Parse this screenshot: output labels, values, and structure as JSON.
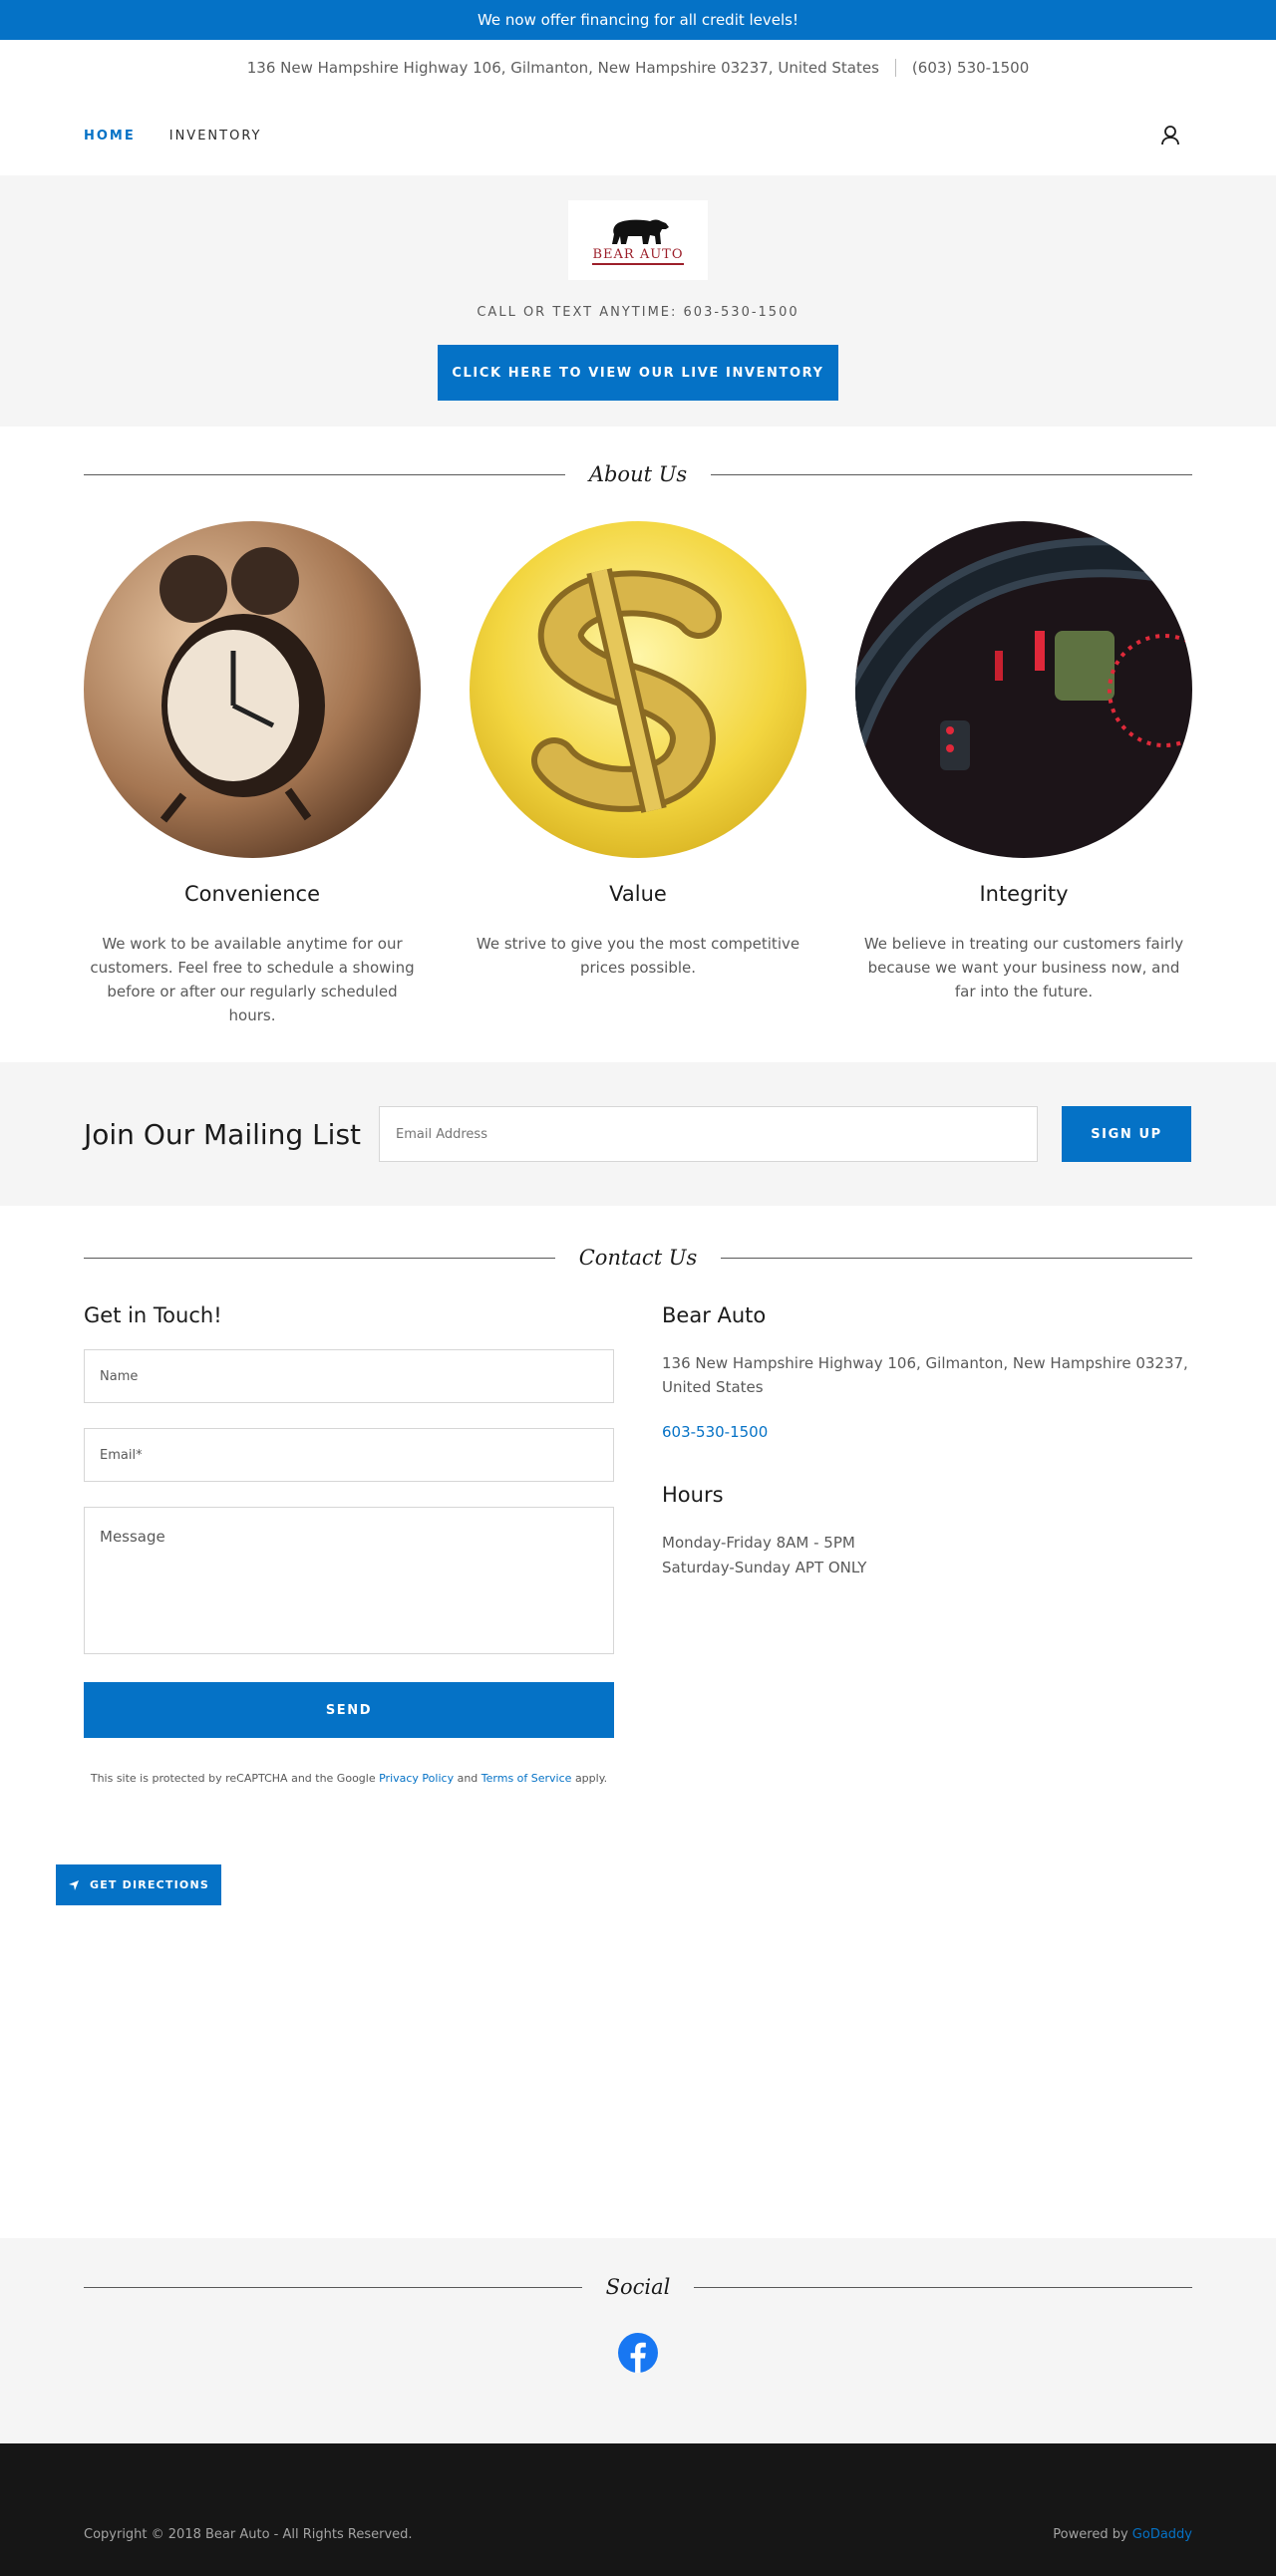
{
  "announcement": "We now offer financing for all credit levels!",
  "contact_bar": {
    "address": "136 New Hampshire Highway 106, Gilmanton, New Hampshire 03237, United States",
    "phone": "(603) 530-1500"
  },
  "nav": {
    "items": [
      {
        "label": "Home",
        "active": true
      },
      {
        "label": "Inventory",
        "active": false
      }
    ],
    "account_icon": "user-icon"
  },
  "hero": {
    "logo_text": "BEAR AUTO",
    "tagline": "CALL OR TEXT ANYTIME: 603-530-1500",
    "cta_label": "CLICK HERE TO VIEW OUR LIVE INVENTORY"
  },
  "about": {
    "heading": "About Us",
    "features": [
      {
        "title": "Convenience",
        "text": "We work to be available anytime for our customers.  Feel free to schedule a showing before or after our regularly scheduled hours.",
        "image": "alarm-clock"
      },
      {
        "title": "Value",
        "text": "We strive to give you the most competitive prices possible.",
        "image": "gold-dollar-sign"
      },
      {
        "title": "Integrity",
        "text": "We believe in treating our customers fairly because we want your business now, and far into the future.",
        "image": "car-dashboard"
      }
    ]
  },
  "mailing": {
    "heading": "Join Our Mailing List",
    "email_placeholder": "Email Address",
    "signup_label": "SIGN UP"
  },
  "contact": {
    "heading": "Contact Us",
    "form_title": "Get in Touch!",
    "name_placeholder": "Name",
    "email_placeholder": "Email*",
    "message_placeholder": "Message",
    "send_label": "SEND",
    "recaptcha_prefix": "This site is protected by reCAPTCHA and the Google",
    "privacy_link": "Privacy Policy",
    "recaptcha_and": "and",
    "terms_link": "Terms of Service",
    "recaptcha_suffix": "apply.",
    "business_name": "Bear Auto",
    "address": "136 New Hampshire Highway 106, Gilmanton, New Hampshire 03237, United States",
    "phone": "603-530-1500",
    "hours_title": "Hours",
    "hours_weekday": "Monday-Friday 8AM - 5PM",
    "hours_weekend": "Saturday-Sunday APT ONLY",
    "directions_label": "GET DIRECTIONS"
  },
  "social": {
    "heading": "Social",
    "icons": [
      "facebook-icon"
    ],
    "facebook_color": "#1877f2"
  },
  "footer": {
    "copyright": "Copyright © 2018 Bear Auto - All Rights Reserved.",
    "powered_prefix": "Powered by",
    "powered_link": "GoDaddy"
  },
  "colors": {
    "accent": "#0572c6",
    "section_bg": "#f5f5f5",
    "footer_bg": "#161616",
    "logo_red": "#9c1f2a"
  }
}
